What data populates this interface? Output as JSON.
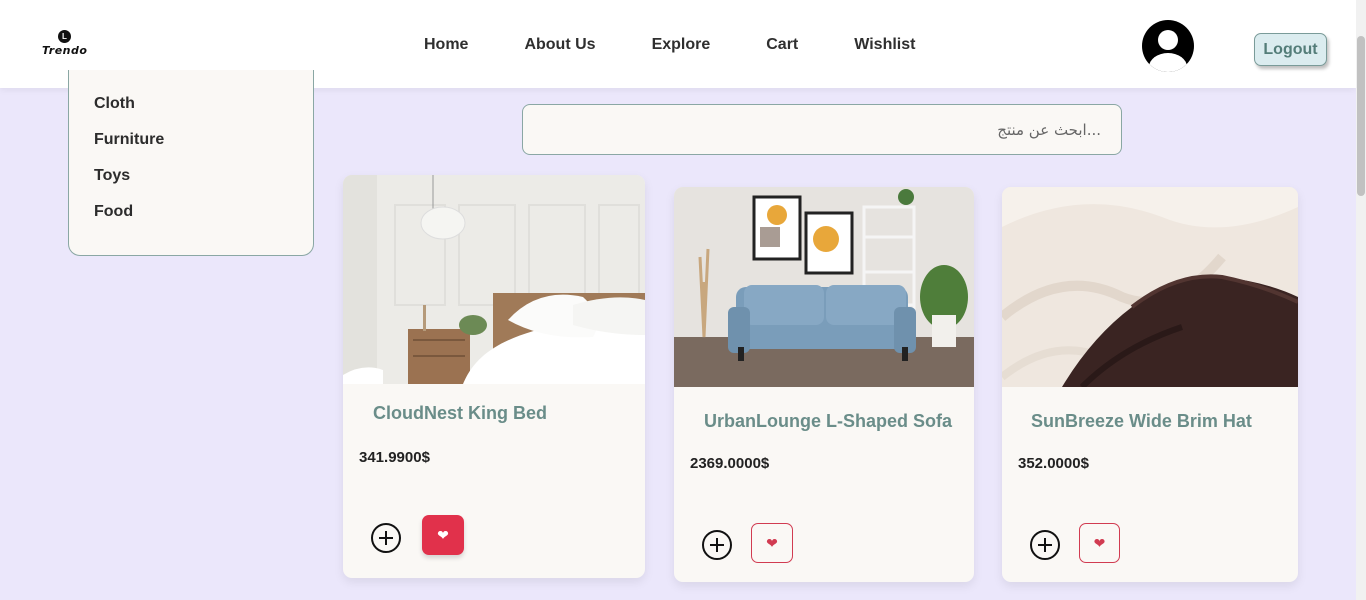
{
  "brand": {
    "logo_text": "Trendo",
    "logo_mark": "L"
  },
  "nav": {
    "links": [
      "Home",
      "About Us",
      "Explore",
      "Cart",
      "Wishlist"
    ]
  },
  "header": {
    "avatar_icon": "user-avatar-icon",
    "logout_label": "Logout"
  },
  "sidebar": {
    "categories": [
      "Cloth",
      "Furniture",
      "Toys",
      "Food"
    ]
  },
  "search": {
    "placeholder": "...ابحث عن منتج"
  },
  "products": [
    {
      "title": "CloudNest King Bed",
      "price": "341.9900$",
      "wishlisted": true
    },
    {
      "title": "UrbanLounge L-Shaped Sofa",
      "price": "2369.0000$",
      "wishlisted": false
    },
    {
      "title": "SunBreeze Wide Brim Hat",
      "price": "352.0000$",
      "wishlisted": false
    }
  ],
  "icons": {
    "add": "plus-circle-icon",
    "wishlist": "heart-icon"
  },
  "colors": {
    "background": "#ebe7fb",
    "accent": "#6a8d89",
    "heart": "#e1314b"
  }
}
